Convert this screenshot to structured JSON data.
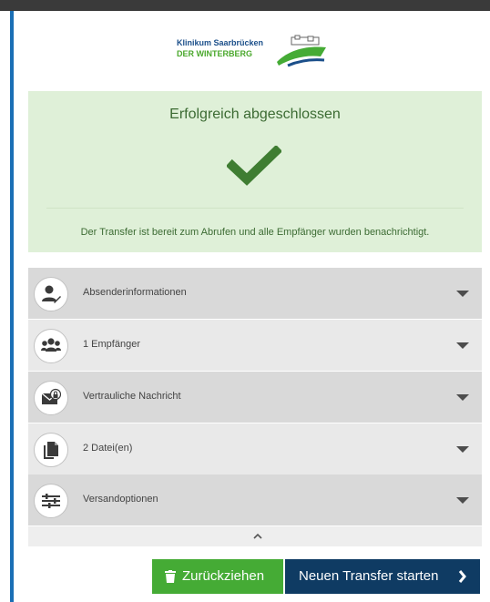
{
  "header": {
    "logo_line1": "Klinikum Saarbrücken",
    "logo_line2": "DER WINTERBERG"
  },
  "status": {
    "title": "Erfolgreich abgeschlossen",
    "message": "Der Transfer ist bereit zum Abrufen und alle Empfänger wurden benachrichtigt.",
    "icon": "checkmark-icon"
  },
  "sections": [
    {
      "label": "Absenderinformationen",
      "icon": "user-edit-icon"
    },
    {
      "label": "1 Empfänger",
      "icon": "users-icon"
    },
    {
      "label": "Vertrauliche Nachricht",
      "icon": "lock-envelope-icon"
    },
    {
      "label": "2 Datei(en)",
      "icon": "files-icon"
    },
    {
      "label": "Versandoptionen",
      "icon": "sliders-icon"
    }
  ],
  "actions": {
    "retract_label": "Zurückziehen",
    "new_transfer_label": "Neuen Transfer starten"
  },
  "colors": {
    "success_bg": "#dff0d8",
    "success_text": "#3c6b33",
    "check": "#3f7d32",
    "retract_button": "#45ab35",
    "new_transfer_button": "#0f3b63",
    "left_accent": "#1a6fb5"
  }
}
